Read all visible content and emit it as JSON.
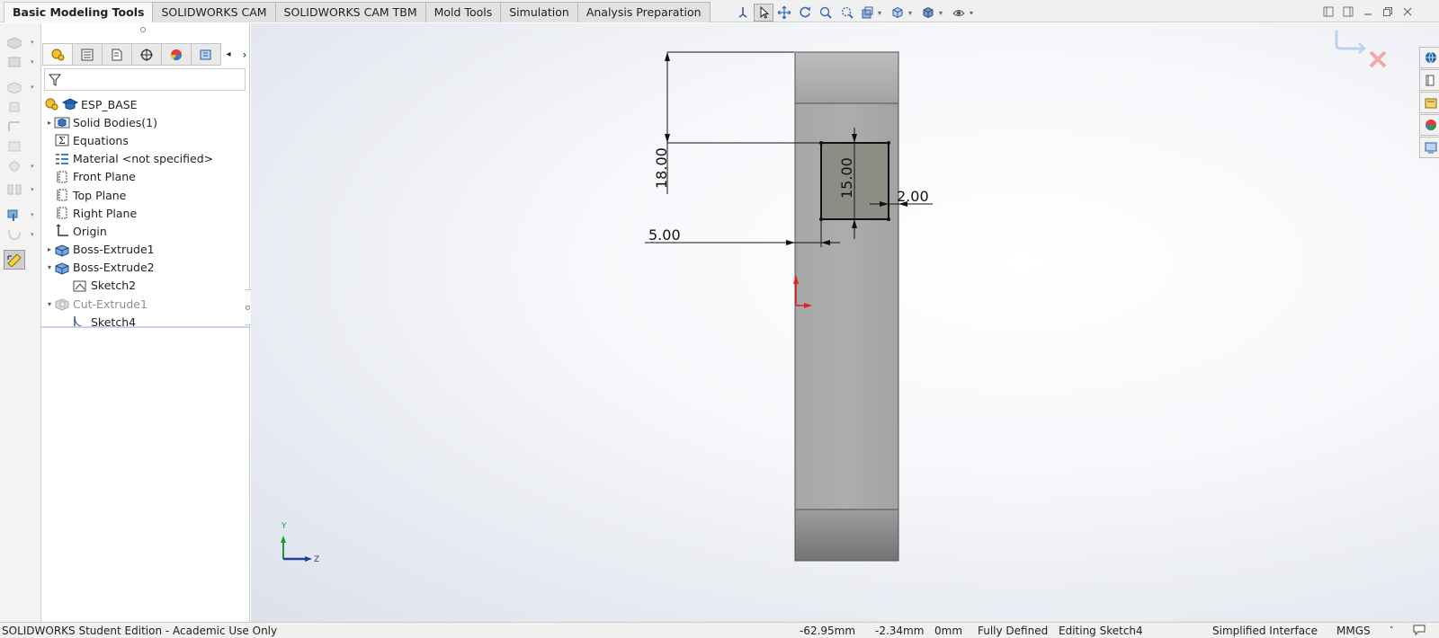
{
  "tabs": [
    {
      "label": "Basic Modeling Tools",
      "active": true
    },
    {
      "label": "SOLIDWORKS CAM",
      "active": false
    },
    {
      "label": "SOLIDWORKS CAM TBM",
      "active": false
    },
    {
      "label": "Mold Tools",
      "active": false
    },
    {
      "label": "Simulation",
      "active": false
    },
    {
      "label": "Analysis Preparation",
      "active": false
    }
  ],
  "feature_tree": {
    "root": "ESP_BASE",
    "items": [
      {
        "label": "Solid Bodies(1)",
        "icon": "solid-bodies-folder-icon",
        "expander": "collapsed"
      },
      {
        "label": "Equations",
        "icon": "equations-icon",
        "expander": "none"
      },
      {
        "label": "Material <not specified>",
        "icon": "material-icon",
        "expander": "none"
      },
      {
        "label": "Front Plane",
        "icon": "plane-icon",
        "expander": "none"
      },
      {
        "label": "Top Plane",
        "icon": "plane-icon",
        "expander": "none"
      },
      {
        "label": "Right Plane",
        "icon": "plane-icon",
        "expander": "none"
      },
      {
        "label": "Origin",
        "icon": "origin-icon",
        "expander": "none"
      },
      {
        "label": "Boss-Extrude1",
        "icon": "extrude-icon",
        "expander": "collapsed"
      },
      {
        "label": "Boss-Extrude2",
        "icon": "extrude-icon",
        "expander": "expanded"
      },
      {
        "label": "Sketch2",
        "icon": "sketch-icon",
        "expander": "none",
        "indent": true
      },
      {
        "label": "Cut-Extrude1",
        "icon": "cut-extrude-icon",
        "expander": "expanded",
        "dim": true
      },
      {
        "label": "Sketch4",
        "icon": "sketch-icon",
        "expander": "none",
        "indent": true
      }
    ]
  },
  "dimensions": {
    "d18": "18.00",
    "d15": "15.00",
    "d2": "2.00",
    "d5": "5.00"
  },
  "triad": {
    "y_label": "Y",
    "z_label": "Z"
  },
  "statusbar": {
    "edition": "SOLIDWORKS Student Edition - Academic Use Only",
    "x": "-62.95mm",
    "y": "-2.34mm",
    "z": "0mm",
    "state": "Fully Defined",
    "editing": "Editing Sketch4",
    "interface": "Simplified Interface",
    "units": "MMGS",
    "caret": "˄"
  },
  "colors": {
    "part_face": "#a9a9a9",
    "part_edge": "#505050",
    "sketch_fill": "#8c8e86",
    "origin_red": "#e31e24",
    "triad_blue": "#1f3f9e",
    "triad_green": "#1b9a3a"
  }
}
